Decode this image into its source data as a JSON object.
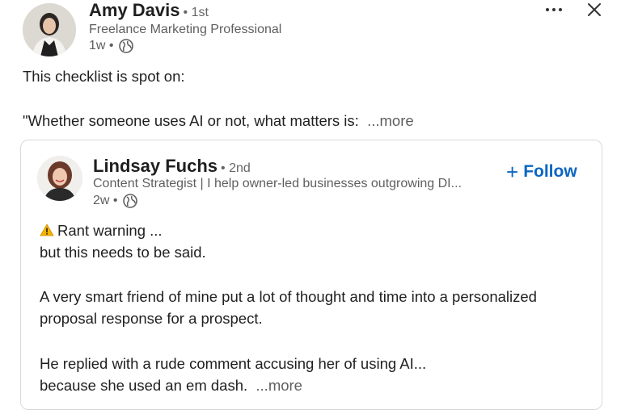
{
  "post": {
    "author": {
      "name": "Amy Davis",
      "degree": "• 1st",
      "headline": "Freelance Marketing Professional",
      "time": "1w •"
    },
    "lines": [
      "This checklist is spot on:",
      "\"Whether someone uses AI or not, what matters is:"
    ],
    "see_more": "...more"
  },
  "shared": {
    "author": {
      "name": "Lindsay Fuchs",
      "degree": "• 2nd",
      "headline": "Content Strategist | I help owner-led businesses outgrowing DI...",
      "time": "2w •"
    },
    "follow_label": "Follow",
    "lines": [
      "Rant warning ...",
      "but this needs to be said.",
      "A very smart friend of mine put a lot of thought and time into a personalized",
      "proposal response for a prospect.",
      "He replied with a rude comment accusing her of using AI...",
      "because she used an em dash."
    ],
    "see_more": "...more"
  },
  "icons": {
    "more": "ellipsis-icon",
    "close": "close-icon",
    "visibility": "globe-icon",
    "warning": "warning-icon",
    "follow": "plus-icon"
  },
  "colors": {
    "link_blue": "#0a66c2",
    "muted_text": "#5f5f5f",
    "border": "#d9d9d9"
  }
}
